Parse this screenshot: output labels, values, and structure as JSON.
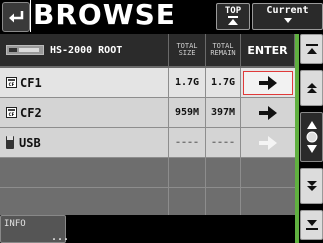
{
  "header": {
    "title": "BROWSE",
    "top_label": "TOP",
    "current_label": "Current"
  },
  "table": {
    "root_label": "HS-2000 ROOT",
    "col_total_size": [
      "TOTAL",
      "SIZE"
    ],
    "col_total_remain": [
      "TOTAL",
      "REMAIN"
    ],
    "col_enter": "ENTER",
    "rows": [
      {
        "name": "CF1",
        "size": "1.7G",
        "remain": "1.7G"
      },
      {
        "name": "CF2",
        "size": "959M",
        "remain": "397M"
      },
      {
        "name": "USB",
        "size": "----",
        "remain": "----"
      }
    ]
  },
  "footer": {
    "info_label": "INFO",
    "info_dots": "..."
  },
  "icons": {
    "back": "back-arrow-icon",
    "enter": "right-arrow-icon",
    "cf": "cf-card-icon",
    "usb": "usb-drive-icon"
  },
  "colors": {
    "scroll_accent": "#60b040",
    "selection_border": "#e03a3a"
  }
}
